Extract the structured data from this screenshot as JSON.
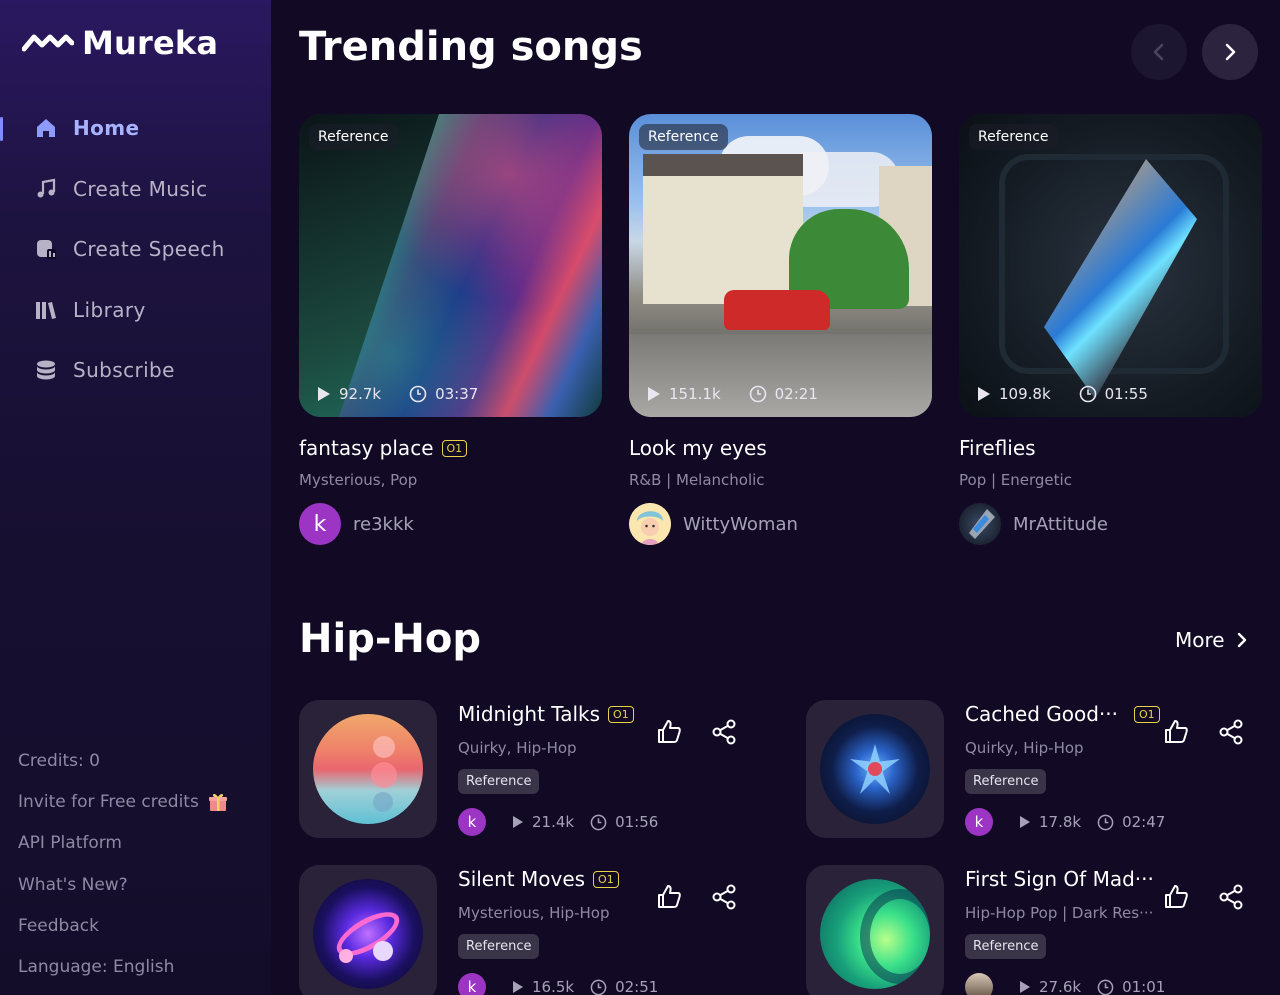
{
  "app": {
    "name": "Mureka"
  },
  "nav": {
    "items": [
      {
        "label": "Home",
        "icon": "home-icon",
        "active": true
      },
      {
        "label": "Create Music",
        "icon": "music-note-icon"
      },
      {
        "label": "Create Speech",
        "icon": "speech-icon"
      },
      {
        "label": "Library",
        "icon": "library-icon"
      },
      {
        "label": "Subscribe",
        "icon": "coins-icon"
      }
    ]
  },
  "sidebar_footer": {
    "credits": "Credits: 0",
    "invite": "Invite for Free credits",
    "api": "API Platform",
    "whats_new": "What's New?",
    "feedback": "Feedback",
    "language": "Language: English"
  },
  "trending": {
    "title": "Trending songs",
    "cards": [
      {
        "tag": "Reference",
        "plays": "92.7k",
        "duration": "03:37",
        "title": "fantasy place",
        "badge": "O1",
        "genre": "Mysterious, Pop",
        "author": "re3kkk",
        "avatar_letter": "k"
      },
      {
        "tag": "Reference",
        "plays": "151.1k",
        "duration": "02:21",
        "title": "Look my eyes",
        "badge": "",
        "genre": "R&B | Melancholic",
        "author": "WittyWoman",
        "avatar_letter": ""
      },
      {
        "tag": "Reference",
        "plays": "109.8k",
        "duration": "01:55",
        "title": "Fireflies",
        "badge": "",
        "genre": "Pop | Energetic",
        "author": "MrAttitude",
        "avatar_letter": ""
      }
    ]
  },
  "hiphop": {
    "title": "Hip-Hop",
    "more": "More",
    "items": [
      {
        "title": "Midnight Talks",
        "badge": "O1",
        "genre": "Quirky, Hip-Hop",
        "tag": "Reference",
        "avatar_letter": "k",
        "plays": "21.4k",
        "duration": "01:56"
      },
      {
        "title": "Cached Good···",
        "badge": "O1",
        "genre": "Quirky, Hip-Hop",
        "tag": "Reference",
        "avatar_letter": "k",
        "plays": "17.8k",
        "duration": "02:47"
      },
      {
        "title": "Silent Moves",
        "badge": "O1",
        "genre": "Mysterious, Hip-Hop",
        "tag": "Reference",
        "avatar_letter": "k",
        "plays": "16.5k",
        "duration": "02:51"
      },
      {
        "title": "First Sign Of Mad···",
        "badge": "",
        "genre": "Hip-Hop Pop | Dark Res···",
        "tag": "Reference",
        "avatar_letter": "",
        "plays": "27.6k",
        "duration": "01:01"
      }
    ]
  },
  "colors": {
    "background": "#120a24",
    "accent": "#a7b3ff",
    "badge": "#e8d24a",
    "avatar": "#9c34c4"
  }
}
